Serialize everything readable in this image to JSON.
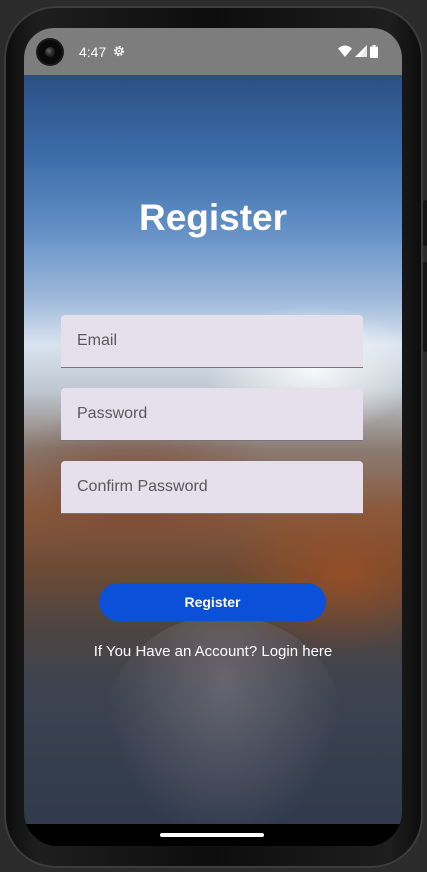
{
  "status_bar": {
    "time": "4:47",
    "icons": [
      "settings-gear-icon",
      "wifi-icon",
      "cellular-signal-icon",
      "battery-icon"
    ]
  },
  "page": {
    "title": "Register"
  },
  "form": {
    "email": {
      "value": "",
      "placeholder": "Email"
    },
    "password": {
      "value": "",
      "placeholder": "Password"
    },
    "confirm_password": {
      "value": "",
      "placeholder": "Confirm Password"
    },
    "submit_label": "Register"
  },
  "login_prompt": "If You Have an Account? Login here",
  "colors": {
    "button": "#0a50d9",
    "field_background": "#e6e0ec",
    "status_bar": "#7d7d7d"
  }
}
